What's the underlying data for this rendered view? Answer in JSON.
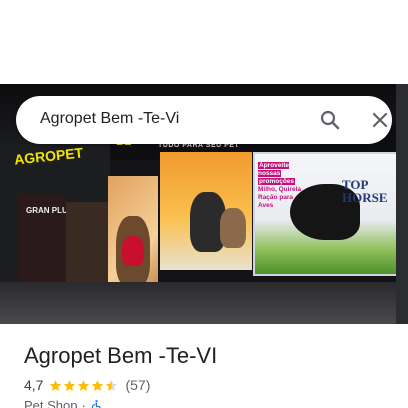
{
  "search": {
    "query": "Agropet Bem -Te-Vi"
  },
  "photo": {
    "storefront_logo": "AGROPET",
    "awning_text": "TUDO PARA SEU PET",
    "panel_text": "GRAN PLUS",
    "promo_line1": "Aproveite nossas",
    "promo_line2": "promoções",
    "promo_line3": "Milho, Quirela Ração para Aves",
    "brand_text": "TOP HORSE"
  },
  "place": {
    "title": "Agropet Bem -Te-VI",
    "rating": "4,7",
    "stars": 4.5,
    "reviews": "(57)",
    "category": "Pet Shop",
    "separator": "·"
  },
  "colors": {
    "star": "#fbbc04",
    "accessibility": "#1a73e8"
  }
}
